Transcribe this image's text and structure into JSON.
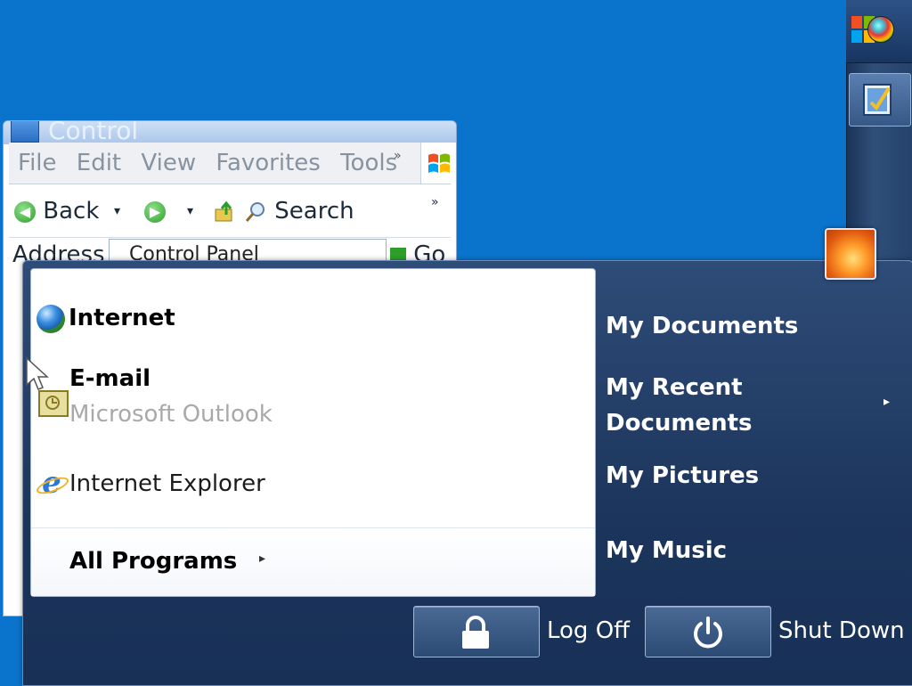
{
  "control_panel": {
    "title": "Control",
    "menu": [
      "File",
      "Edit",
      "View",
      "Favorites",
      "Tools"
    ],
    "menu_more": "»",
    "toolbar": {
      "back_label": "Back",
      "search_label": "Search",
      "more": "»",
      "dropdown": "▾"
    },
    "address": {
      "label": "Address",
      "value": "Control Panel",
      "go_label": "Go"
    }
  },
  "start_menu": {
    "pinned": [
      {
        "title": "Internet",
        "icon": "globe-icon"
      },
      {
        "title": "E-mail",
        "subtitle": "Microsoft Outlook",
        "icon": "email-icon"
      }
    ],
    "recent": [
      {
        "title": "Internet Explorer",
        "icon": "internet-explorer-icon"
      }
    ],
    "all_programs": "All Programs",
    "submenu_arrow": "▸",
    "right_items": [
      {
        "label": "My Documents"
      },
      {
        "label": "My Recent Documents",
        "has_submenu": true
      },
      {
        "label": "My Pictures"
      },
      {
        "label": "My Music"
      }
    ],
    "log_off_label": "Log Off",
    "shut_down_label": "Shut Down"
  },
  "taskbar": {
    "start_icon": "windows-start-orb-icon",
    "app_icon": "control-panel-icon"
  },
  "colors": {
    "desktop": "#0a74cc",
    "start_menu_bg": "#1c355c",
    "taskbar_bg": "#24426b"
  }
}
